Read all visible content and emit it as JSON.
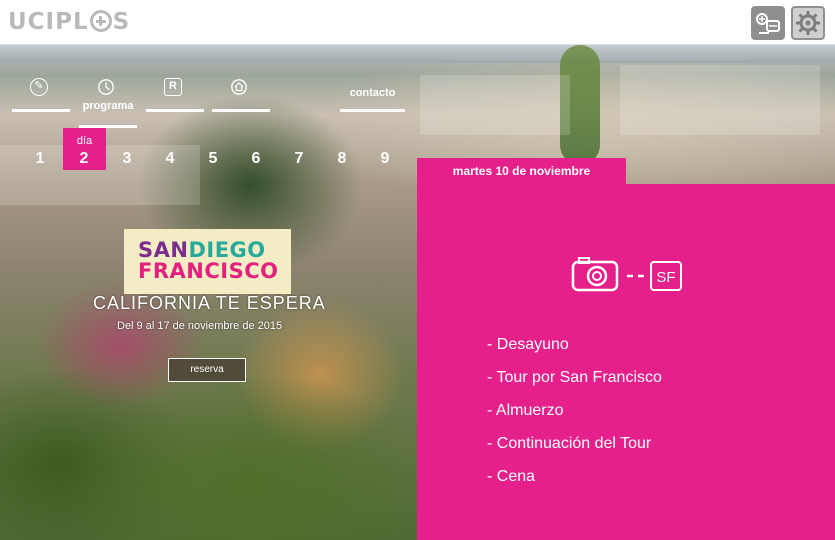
{
  "logo": {
    "text_before": "UCIPL",
    "text_after": "S"
  },
  "toolbar": {
    "buttons": [
      {
        "icon": "profile-card-icon"
      },
      {
        "icon": "gear-icon"
      }
    ]
  },
  "nav": {
    "items": [
      {
        "icon": "pencil-icon",
        "label": ""
      },
      {
        "icon": "clock-icon",
        "label": "programa"
      },
      {
        "icon": "letter-r-icon",
        "label": ""
      },
      {
        "icon": "home-icon",
        "label": ""
      },
      {
        "icon": "",
        "label": "contacto"
      }
    ]
  },
  "days": {
    "label": "día",
    "selected": 2,
    "items": [
      "1",
      "2",
      "3",
      "4",
      "5",
      "6",
      "7",
      "8",
      "9"
    ]
  },
  "promo": {
    "logo_line1_a": "SAN",
    "logo_line1_b": "DIEGO",
    "logo_line2": "FRANCISCO",
    "tagline": "CALIFORNIA TE ESPERA",
    "dates": "Del 9 al 17 de noviembre de 2015",
    "button_label": "reserva"
  },
  "panel": {
    "date": "martes 10 de noviembre",
    "icons": {
      "left": "camera-icon",
      "right_badge": "SF"
    },
    "schedule": [
      "- Desayuno",
      "- Tour por San Francisco",
      "- Almuerzo",
      "- Continuación del Tour",
      "- Cena"
    ],
    "color": "#e6208b"
  }
}
